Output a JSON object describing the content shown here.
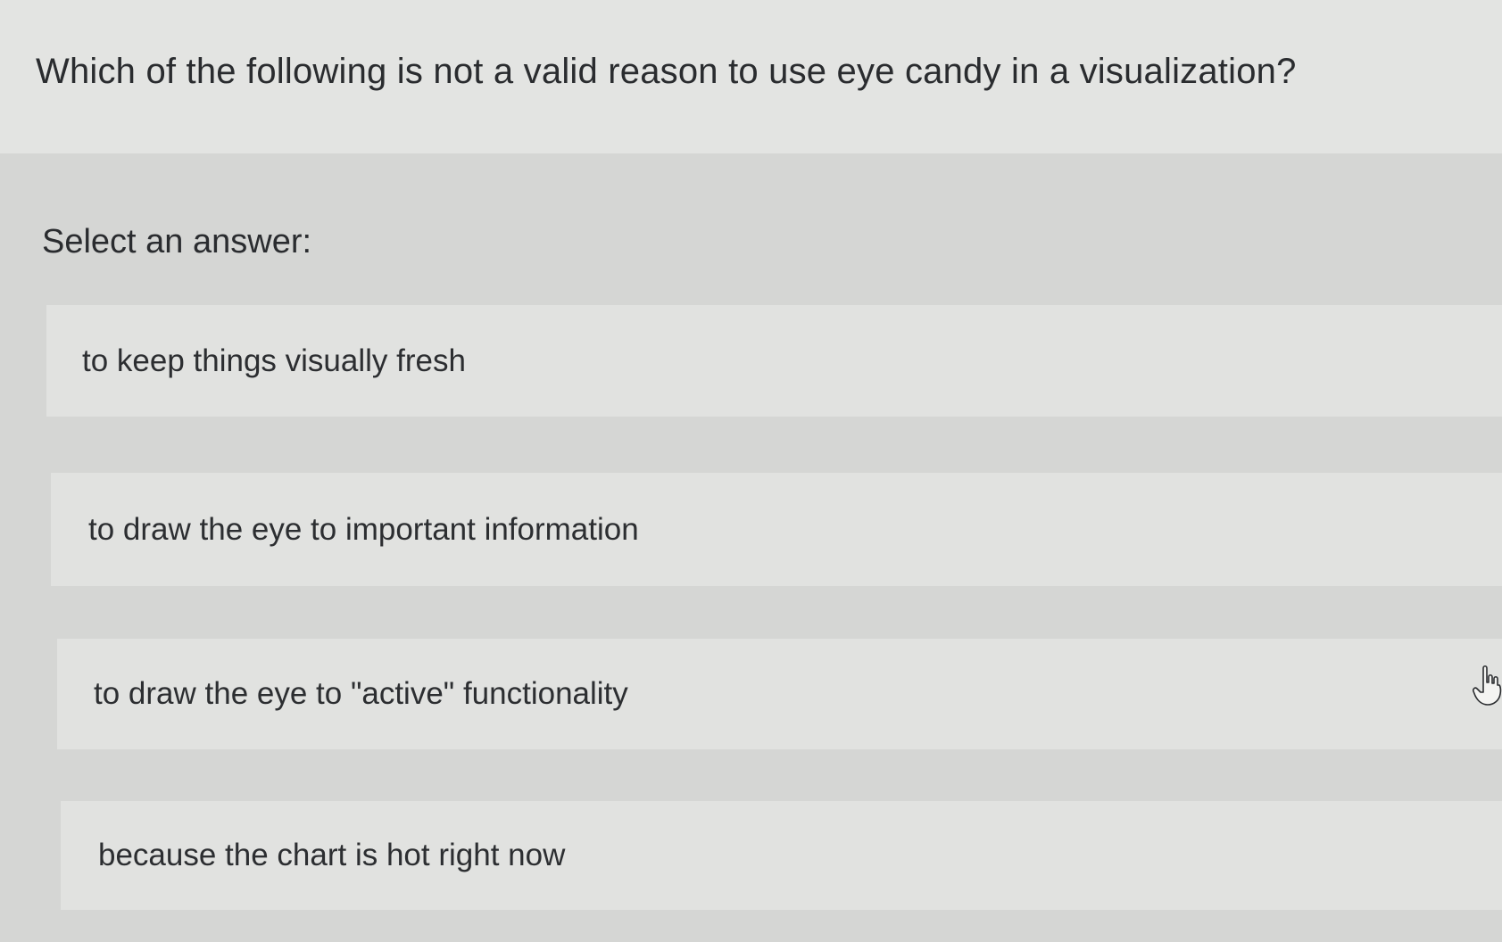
{
  "question": {
    "text": "Which of the following is not a valid reason to use eye candy in a visualization?"
  },
  "prompt": {
    "text": "Select an answer:"
  },
  "options": [
    {
      "label": "to keep things visually fresh"
    },
    {
      "label": "to draw the eye to important information"
    },
    {
      "label": "to draw the eye to \"active\" functionality"
    },
    {
      "label": "because the chart is hot right now"
    }
  ],
  "cursor": {
    "icon": "hand-pointer-icon"
  },
  "colors": {
    "background": "#d6d7d5",
    "question_panel": "#e3e4e2",
    "option_background": "#e1e2e0",
    "text": "#2b2d30"
  }
}
